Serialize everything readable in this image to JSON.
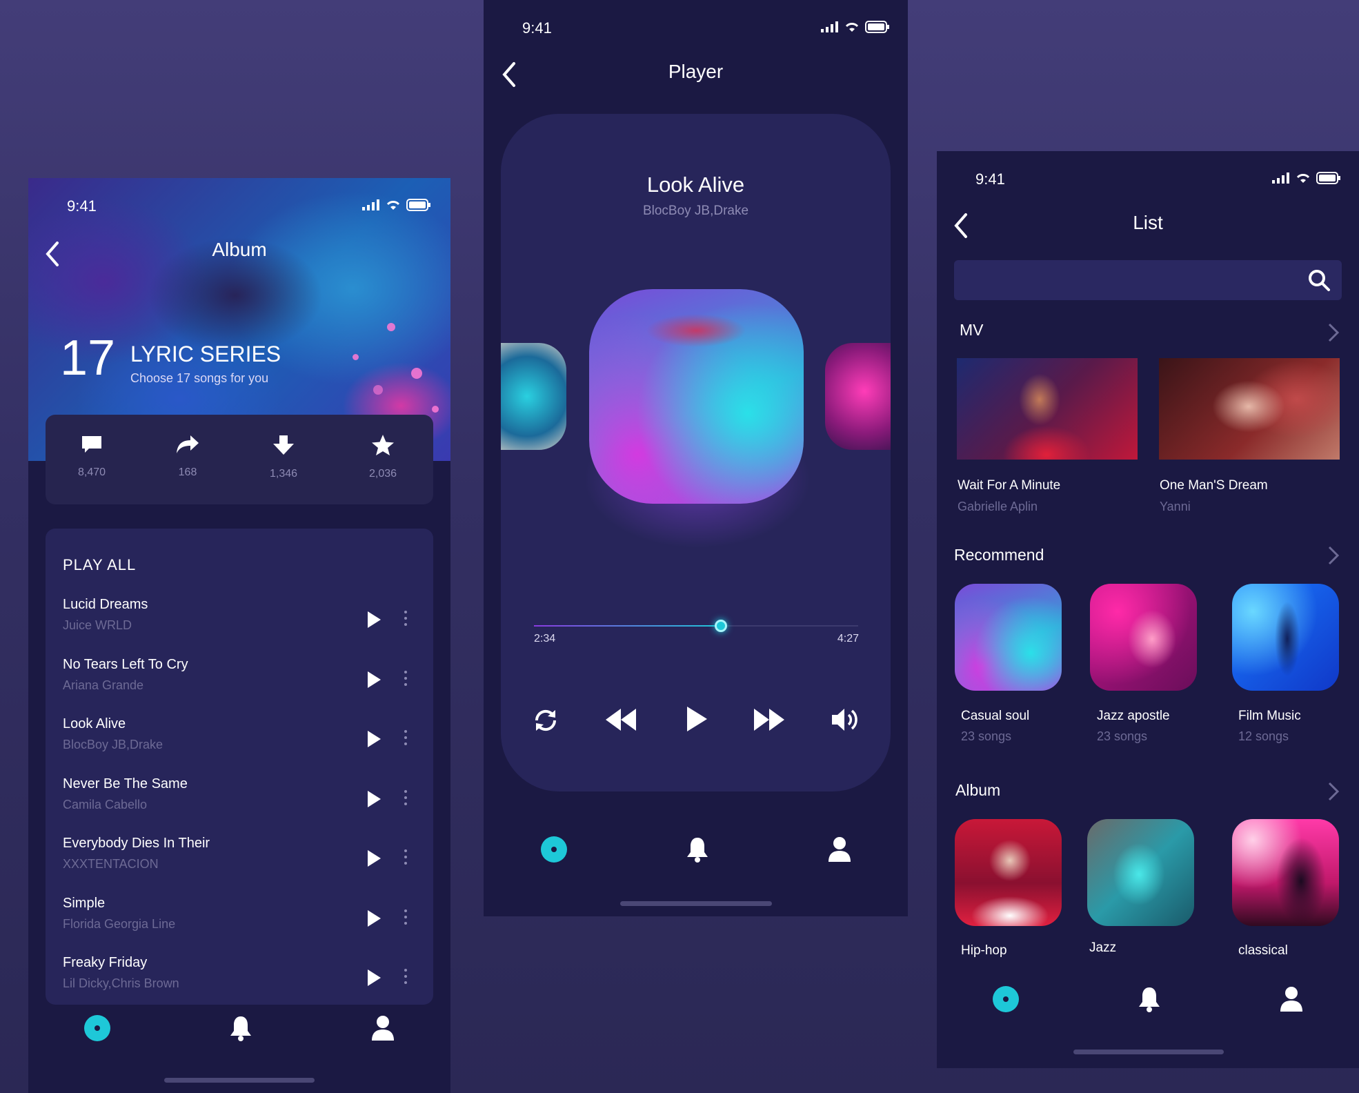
{
  "status_time": "9:41",
  "album_screen": {
    "title": "Album",
    "hero_number": "17",
    "series_title": "LYRIC SERIES",
    "series_subtitle": "Choose 17 songs for you",
    "stats": [
      {
        "icon": "comment-icon",
        "value": "8,470"
      },
      {
        "icon": "share-icon",
        "value": "168"
      },
      {
        "icon": "download-icon",
        "value": "1,346"
      },
      {
        "icon": "star-icon",
        "value": "2,036"
      }
    ],
    "play_all_label": "PLAY ALL",
    "songs": [
      {
        "title": "Lucid Dreams",
        "artist": "Juice WRLD"
      },
      {
        "title": "No Tears Left To Cry",
        "artist": "Ariana Grande"
      },
      {
        "title": "Look Alive",
        "artist": "BlocBoy JB,Drake"
      },
      {
        "title": "Never Be The Same",
        "artist": "Camila Cabello"
      },
      {
        "title": "Everybody Dies In Their",
        "artist": "XXXTENTACION"
      },
      {
        "title": "Simple",
        "artist": "Florida Georgia Line"
      },
      {
        "title": "Freaky Friday",
        "artist": "Lil Dicky,Chris Brown"
      }
    ]
  },
  "player_screen": {
    "title": "Player",
    "song_title": "Look Alive",
    "song_artist": "BlocBoy JB,Drake",
    "elapsed": "2:34",
    "duration": "4:27",
    "progress_fraction": 0.577,
    "controls": [
      "repeat-icon",
      "rewind-icon",
      "play-icon",
      "fast-forward-icon",
      "volume-icon"
    ]
  },
  "list_screen": {
    "title": "List",
    "search_placeholder": "",
    "mv_section": "MV",
    "mv_items": [
      {
        "title": "Wait For A Minute",
        "artist": "Gabrielle Aplin"
      },
      {
        "title": "One Man'S Dream",
        "artist": "Yanni"
      }
    ],
    "recommend_section": "Recommend",
    "recommend_items": [
      {
        "title": "Casual soul",
        "count": "23 songs"
      },
      {
        "title": "Jazz apostle",
        "count": "23 songs"
      },
      {
        "title": "Film Music",
        "count": "12 songs"
      }
    ],
    "album_section": "Album",
    "album_items": [
      {
        "title": "Hip-hop"
      },
      {
        "title": "Jazz"
      },
      {
        "title": "classical"
      }
    ]
  },
  "tabbar": {
    "items": [
      "disc-icon",
      "bell-icon",
      "profile-icon"
    ],
    "accent": "#1ec8d8"
  },
  "colors": {
    "background": "#1b1943",
    "card": "#27255a",
    "accent": "#1ec8d8",
    "muted": "#6d6a95"
  }
}
